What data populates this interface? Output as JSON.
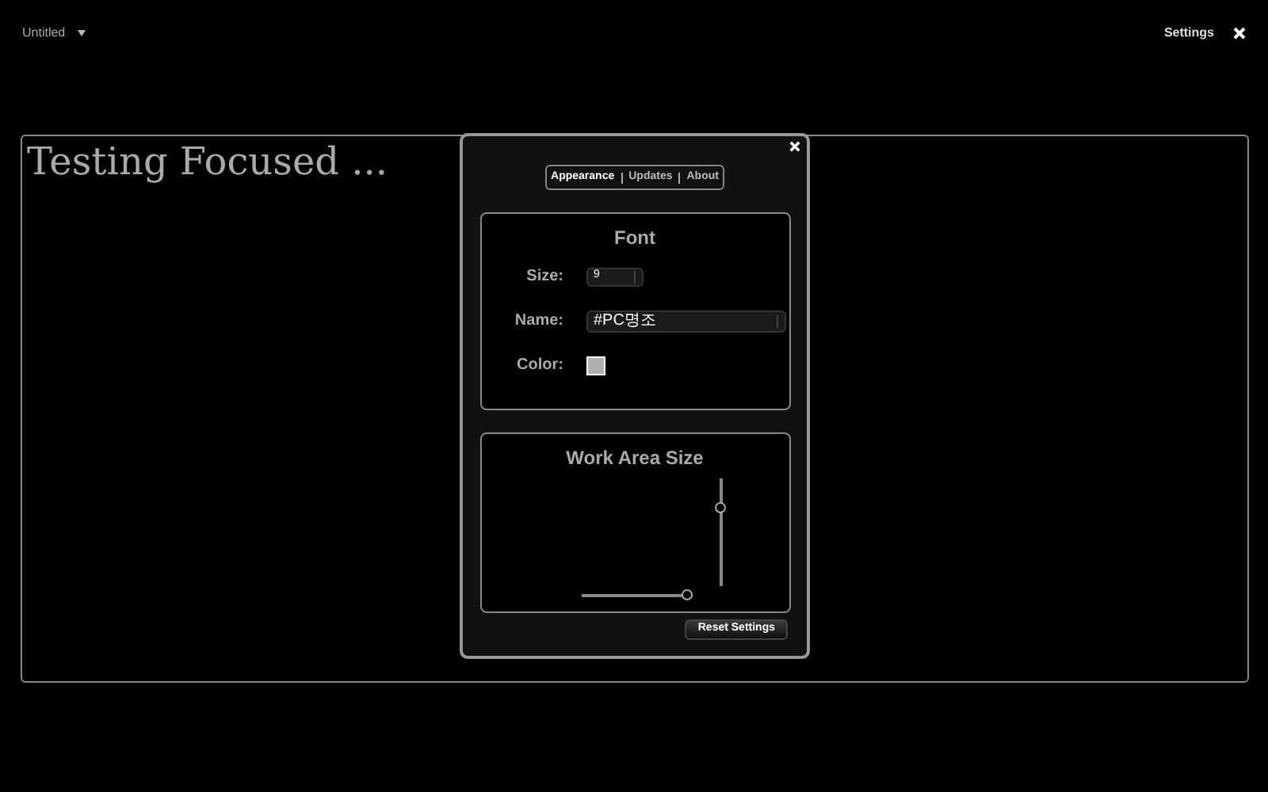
{
  "top_bar": {
    "document_title": "Untitled",
    "settings_link": "Settings"
  },
  "editor": {
    "text": "Testing Focused ..."
  },
  "settings_dialog": {
    "tabs": [
      {
        "label": "Appearance",
        "selected": true
      },
      {
        "label": "Updates",
        "selected": false
      },
      {
        "label": "About",
        "selected": false
      }
    ],
    "font": {
      "title": "Font",
      "size_label": "Size:",
      "size_value": "9",
      "name_label": "Name:",
      "name_value": "#PC명조",
      "color_label": "Color:",
      "color": "#b0b0b0"
    },
    "work_area": {
      "title": "Work Area Size",
      "width_slider": {
        "level": 1
      },
      "height_slider": {
        "level": 0.75
      }
    },
    "reset_button": "Reset Settings"
  }
}
